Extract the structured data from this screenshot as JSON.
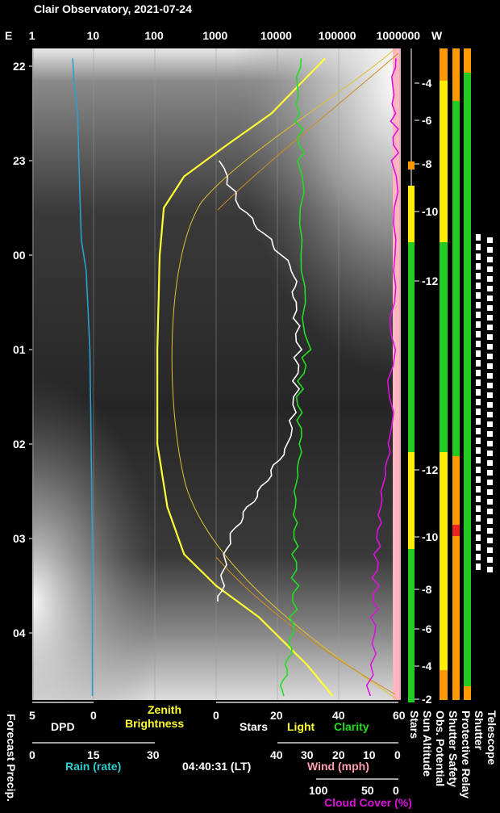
{
  "title": "Clair Observatory, 2021-07-24",
  "header": {
    "left_label": "E",
    "right_label": "W",
    "brightness_ticks": [
      "1",
      "10",
      "100",
      "1000",
      "10000",
      "100000",
      "1000000"
    ]
  },
  "time_axis": {
    "labels": [
      "22",
      "23",
      "00",
      "01",
      "02",
      "03",
      "04"
    ]
  },
  "sun_altitude_axis": {
    "labels": [
      "-4",
      "-6",
      "-8",
      "-10",
      "-12",
      "-12",
      "-10",
      "-8",
      "-6",
      "-4",
      "-2"
    ]
  },
  "bottom": {
    "dpd_ticks": [
      "5",
      "0"
    ],
    "dpd_label": "DPD",
    "zenith_label_1": "Zenith",
    "zenith_label_2": "Brightness",
    "stars_ticks": [
      "0",
      "20",
      "40",
      "60"
    ],
    "stars_label": "Stars",
    "light_label": "Light",
    "clarity_label": "Clarity",
    "rain_ticks": [
      "0",
      "15",
      "30"
    ],
    "rain_label": "Rain (rate)",
    "time_value": "04:40:31 (LT)",
    "wind_ticks": [
      "40",
      "30",
      "20",
      "10",
      "0"
    ],
    "wind_label": "Wind (mph)",
    "cloud_ticks": [
      "100",
      "50",
      "0"
    ],
    "cloud_label": "Cloud Cover (%)"
  },
  "vertical_labels": {
    "forecast": "Forecast Precip.",
    "stars": "Stars",
    "sun_altitude": "Sun Altitude",
    "obs_potential": "Obs. Potential",
    "shutter_safety": "Shutter Safety",
    "protective_relay": "Protective Relay",
    "shutter": "Shutter",
    "telescope": "Telescope"
  },
  "colors": {
    "dpd": "#2aa0d0",
    "zenith": "#ffff33",
    "stars": "#ffffff",
    "clarity": "#22dd22",
    "cloud": "#dd11dd",
    "rain": "#33cccc",
    "wind": "#ff9fb0",
    "status_orange": "#ff9900",
    "status_green": "#22cc22",
    "status_yellow": "#ffee00"
  },
  "chart_data": {
    "type": "line",
    "title": "Clair Observatory, 2021-07-24",
    "xscale": "log",
    "xlim": [
      1,
      1000000
    ],
    "y_time_range": [
      "21:50",
      "04:40"
    ],
    "series": [
      {
        "name": "Zenith Brightness",
        "unit": "log scale",
        "points": [
          [
            "21:55",
            60000
          ],
          [
            "22:30",
            8000
          ],
          [
            "22:50",
            1500
          ],
          [
            "23:10",
            300
          ],
          [
            "23:30",
            140
          ],
          [
            "00:00",
            120
          ],
          [
            "01:00",
            110
          ],
          [
            "02:00",
            110
          ],
          [
            "02:40",
            160
          ],
          [
            "03:10",
            300
          ],
          [
            "03:30",
            1000
          ],
          [
            "03:50",
            5000
          ],
          [
            "04:20",
            30000
          ],
          [
            "04:40",
            80000
          ]
        ]
      },
      {
        "name": "Stars",
        "unit": "count (0-60)",
        "points": [
          [
            "23:00",
            1
          ],
          [
            "23:30",
            8
          ],
          [
            "23:50",
            18
          ],
          [
            "00:10",
            25
          ],
          [
            "00:30",
            26
          ],
          [
            "01:00",
            27
          ],
          [
            "01:30",
            26
          ],
          [
            "02:00",
            24
          ],
          [
            "02:20",
            18
          ],
          [
            "02:40",
            10
          ],
          [
            "03:00",
            5
          ],
          [
            "03:20",
            2
          ],
          [
            "03:40",
            1
          ]
        ]
      },
      {
        "name": "Clarity",
        "unit": "count (0-60)",
        "points": [
          [
            "21:55",
            28
          ],
          [
            "22:30",
            27
          ],
          [
            "23:00",
            28
          ],
          [
            "00:00",
            28
          ],
          [
            "01:00",
            30
          ],
          [
            "01:30",
            27
          ],
          [
            "02:00",
            28
          ],
          [
            "02:30",
            26
          ],
          [
            "03:00",
            26
          ],
          [
            "03:30",
            26
          ],
          [
            "04:00",
            25
          ],
          [
            "04:20",
            23
          ],
          [
            "04:40",
            22
          ]
        ]
      },
      {
        "name": "Cloud Cover",
        "unit": "%",
        "points": [
          [
            "21:55",
            3
          ],
          [
            "22:30",
            5
          ],
          [
            "23:00",
            4
          ],
          [
            "00:00",
            4
          ],
          [
            "01:00",
            8
          ],
          [
            "02:00",
            10
          ],
          [
            "02:30",
            20
          ],
          [
            "03:00",
            25
          ],
          [
            "03:30",
            28
          ],
          [
            "04:00",
            30
          ],
          [
            "04:40",
            35
          ]
        ]
      },
      {
        "name": "DPD",
        "unit": "deg",
        "points": [
          [
            "21:55",
            1.7
          ],
          [
            "22:10",
            1.6
          ],
          [
            "22:30",
            1.3
          ],
          [
            "23:00",
            1.2
          ],
          [
            "23:50",
            1.0
          ],
          [
            "00:10",
            0.6
          ],
          [
            "01:00",
            0.3
          ],
          [
            "02:00",
            0.2
          ],
          [
            "03:00",
            0.1
          ],
          [
            "04:00",
            0.1
          ],
          [
            "04:40",
            0.1
          ]
        ]
      }
    ]
  }
}
